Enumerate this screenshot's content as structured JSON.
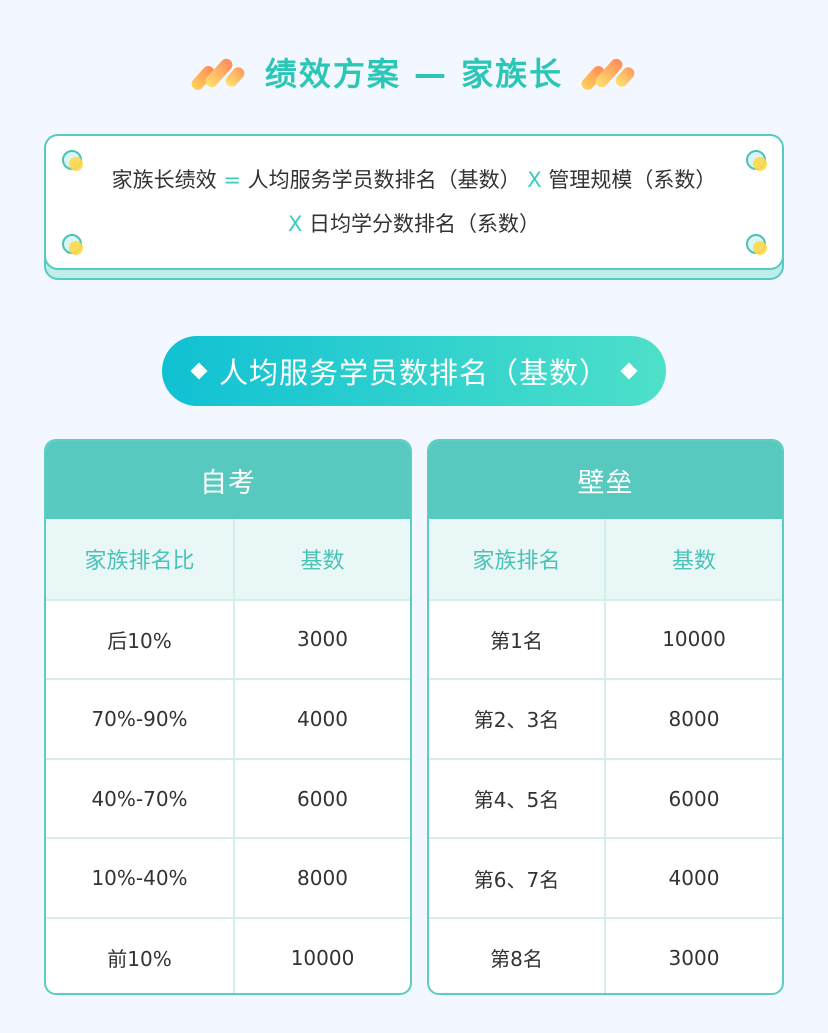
{
  "header": {
    "title": "绩效方案 — 家族长"
  },
  "formula": {
    "lhs": "家族长绩效",
    "eq": "=",
    "term1": "人均服务学员数排名（基数）",
    "times1": "X",
    "term2": "管理规模（系数）",
    "times2": "X",
    "term3": "日均学分数排名（系数）"
  },
  "section": {
    "title": "人均服务学员数排名（基数）"
  },
  "tables": {
    "left": {
      "title": "自考",
      "headers": [
        "家族排名比",
        "基数"
      ],
      "rows": [
        [
          "后10%",
          "3000"
        ],
        [
          "70%-90%",
          "4000"
        ],
        [
          "40%-70%",
          "6000"
        ],
        [
          "10%-40%",
          "8000"
        ],
        [
          "前10%",
          "10000"
        ]
      ]
    },
    "right": {
      "title": "壁垒",
      "headers": [
        "家族排名",
        "基数"
      ],
      "rows": [
        [
          "第1名",
          "10000"
        ],
        [
          "第2、3名",
          "8000"
        ],
        [
          "第4、5名",
          "6000"
        ],
        [
          "第6、7名",
          "4000"
        ],
        [
          "第8名",
          "3000"
        ]
      ]
    }
  },
  "colors": {
    "accent": "#2cc6b6",
    "table_header": "#58c9bf",
    "pill_start": "#10c1d3",
    "pill_end": "#4ee0c9"
  }
}
